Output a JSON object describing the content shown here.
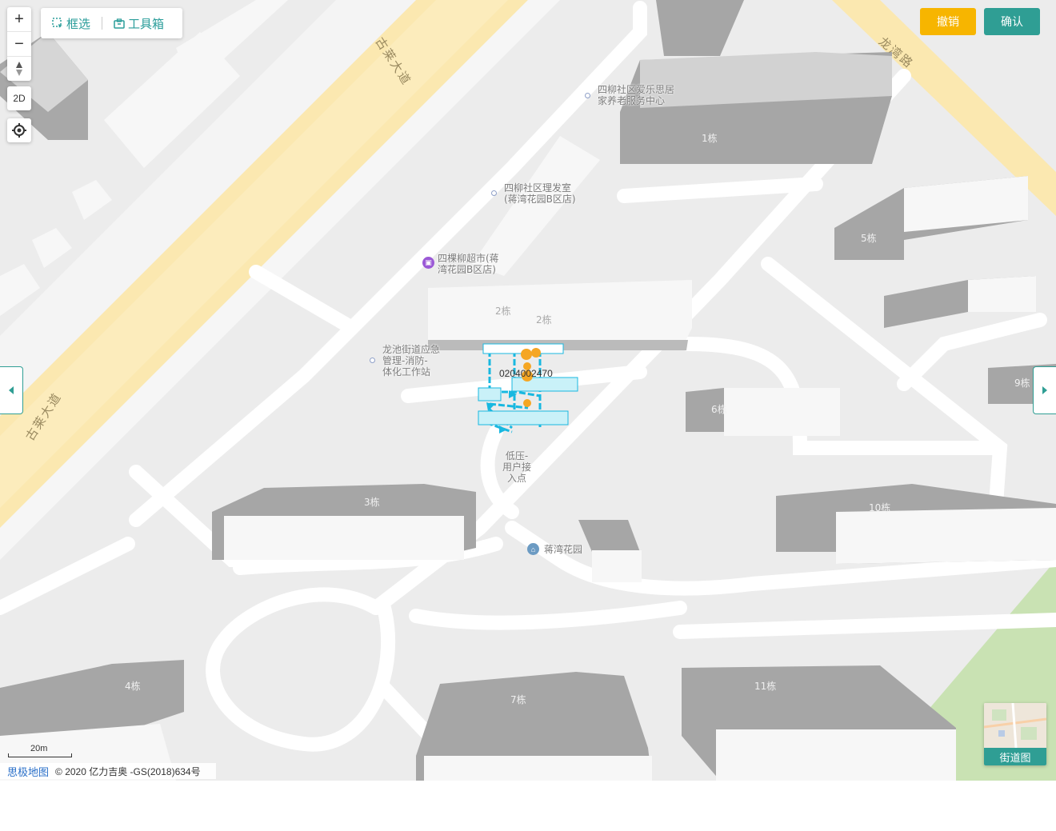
{
  "controls": {
    "zoom_in": "+",
    "zoom_out": "−",
    "compass": "▲▼",
    "mode_2d": "2D",
    "locate_icon": "locate-icon"
  },
  "toolbar": {
    "box_select_label": "框选",
    "toolbox_label": "工具箱"
  },
  "actions": {
    "undo_label": "撤销",
    "confirm_label": "确认"
  },
  "roads": {
    "gulai_upper": "古莱大道",
    "gulai_lower": "古莱大道",
    "longwan": "龙湾路"
  },
  "pois": [
    {
      "text": "四柳社区爱乐思居\n家养老服务中心"
    },
    {
      "text": "四柳社区理发室\n(蒋湾花园B区店)"
    },
    {
      "text": "四棵柳超市(蒋\n湾花园B区店)"
    },
    {
      "text": "龙池街道应急\n管理-消防-\n体化工作站"
    },
    {
      "text": "低压-\n用户接\n入点"
    },
    {
      "text": "蒋湾花园"
    }
  ],
  "buildings": [
    "1栋",
    "5栋",
    "2栋",
    "2栋",
    "9栋",
    "6栋",
    "3栋",
    "10栋",
    "4栋",
    "7栋",
    "11栋"
  ],
  "network": {
    "device_id": "0204002470"
  },
  "footer": {
    "scale_label": "20m",
    "brand": "思极地图",
    "copyright": "© 2020 亿力吉奥 -GS(2018)634号"
  },
  "street_view": {
    "label": "街道图"
  },
  "colors": {
    "accent": "#2f9e94",
    "undo": "#f7b500",
    "network_line": "#19b8e0",
    "node": "#f5a623",
    "arterial": "#fbe8b0",
    "park": "#c9e2b3"
  }
}
